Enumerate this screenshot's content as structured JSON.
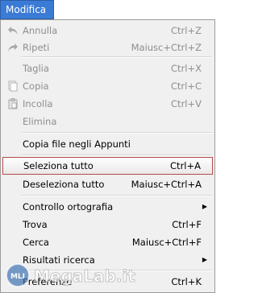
{
  "menu_title": "Modifica",
  "items": [
    {
      "label": "Annulla",
      "shortcut": "Ctrl+Z",
      "icon": "undo-icon"
    },
    {
      "label": "Ripeti",
      "shortcut": "Maiusc+Ctrl+Z",
      "icon": "redo-icon"
    },
    {
      "label": "Taglia",
      "shortcut": "Ctrl+X",
      "icon": ""
    },
    {
      "label": "Copia",
      "shortcut": "Ctrl+C",
      "icon": "copy-icon"
    },
    {
      "label": "Incolla",
      "shortcut": "Ctrl+V",
      "icon": "paste-icon"
    },
    {
      "label": "Elimina",
      "shortcut": "",
      "icon": ""
    },
    {
      "label": "Copia file negli Appunti",
      "shortcut": ""
    },
    {
      "label": "Seleziona tutto",
      "shortcut": "Ctrl+A"
    },
    {
      "label": "Deseleziona tutto",
      "shortcut": "Maiusc+Ctrl+A"
    },
    {
      "label": "Controllo ortografia",
      "shortcut": "",
      "submenu": true
    },
    {
      "label": "Trova",
      "shortcut": "Ctrl+F"
    },
    {
      "label": "Cerca",
      "shortcut": "Maiusc+Ctrl+F"
    },
    {
      "label": "Risultati ricerca",
      "shortcut": "",
      "submenu": true
    },
    {
      "label": "Preferenze",
      "shortcut": "Ctrl+K"
    }
  ],
  "watermark": {
    "badge": "MLI",
    "text": "MegaLab.it"
  },
  "colors": {
    "title_bg": "#3a7bd5",
    "highlight_border": "#b84a4a",
    "disabled_text": "#8e8e8e"
  }
}
